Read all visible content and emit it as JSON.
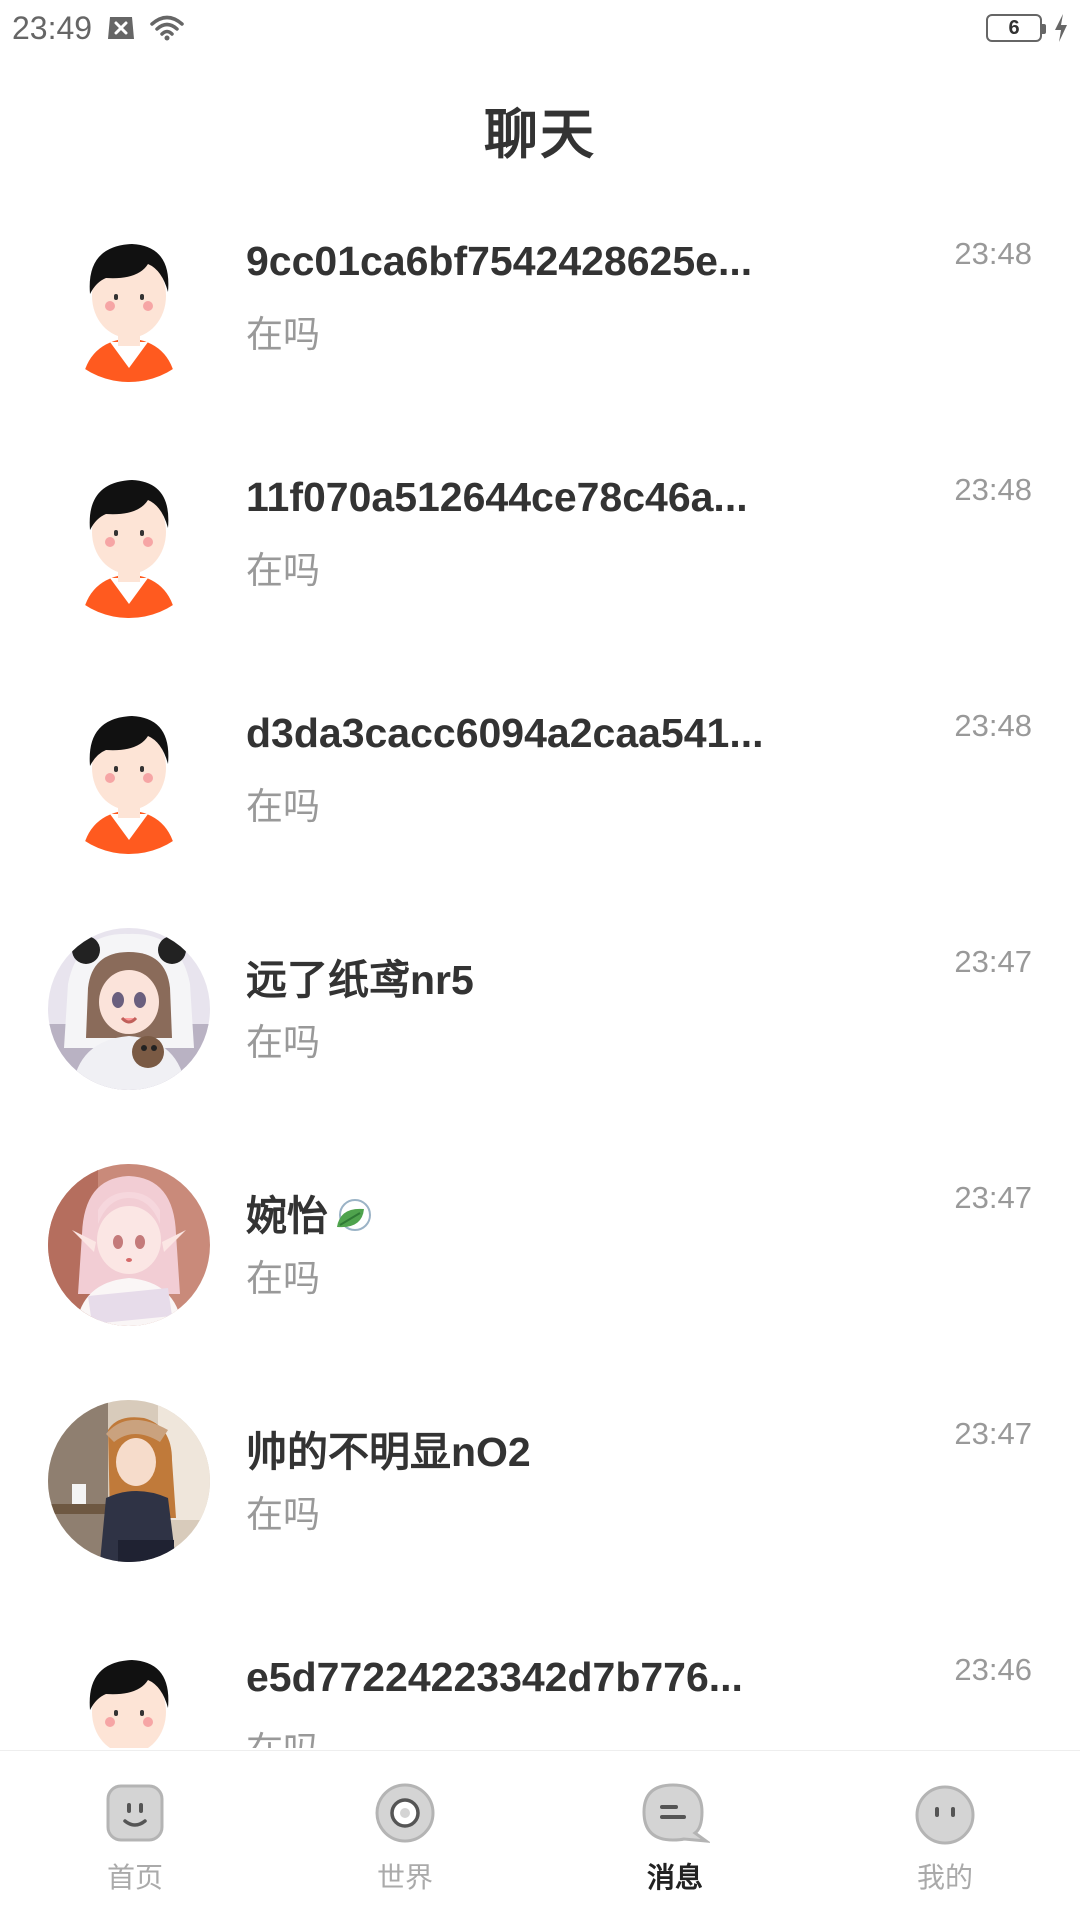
{
  "status_bar": {
    "time": "23:49",
    "battery_level": "6",
    "icons": [
      "notification-x-icon",
      "wifi-icon",
      "battery-icon",
      "charging-bolt-icon"
    ]
  },
  "header": {
    "title": "聊天"
  },
  "chats": [
    {
      "name": "9cc01ca6bf7542428625e...",
      "preview": "在吗",
      "time": "23:48",
      "avatar": "default-boy-avatar"
    },
    {
      "name": "11f070a512644ce78c46a...",
      "preview": "在吗",
      "time": "23:48",
      "avatar": "default-boy-avatar"
    },
    {
      "name": "d3da3cacc6094a2caa541...",
      "preview": "在吗",
      "time": "23:48",
      "avatar": "default-boy-avatar"
    },
    {
      "name": "远了纸鸢nr5",
      "preview": "在吗",
      "time": "23:47",
      "avatar": "anime-girl-panda-hood-avatar"
    },
    {
      "name": "婉怡",
      "preview": "在吗",
      "time": "23:47",
      "avatar": "anime-girl-pink-hair-avatar",
      "name_emoji": "leaf-icon"
    },
    {
      "name": "帅的不明显nO2",
      "preview": "在吗",
      "time": "23:47",
      "avatar": "anime-girl-cafe-avatar"
    },
    {
      "name": "e5d77224223342d7b776...",
      "preview": "在吗",
      "time": "23:46",
      "avatar": "default-boy-avatar"
    }
  ],
  "bottom_nav": {
    "tabs": [
      {
        "label": "首页",
        "icon": "home-face-icon",
        "active": false
      },
      {
        "label": "世界",
        "icon": "world-circle-icon",
        "active": false
      },
      {
        "label": "消息",
        "icon": "message-bubble-icon",
        "active": true
      },
      {
        "label": "我的",
        "icon": "profile-face-icon",
        "active": false
      }
    ]
  },
  "colors": {
    "primary_text": "#333333",
    "secondary_text": "#999999",
    "nav_inactive": "#aaaaaa",
    "nav_active": "#222222",
    "avatar_shirt": "#ff5a1f"
  }
}
